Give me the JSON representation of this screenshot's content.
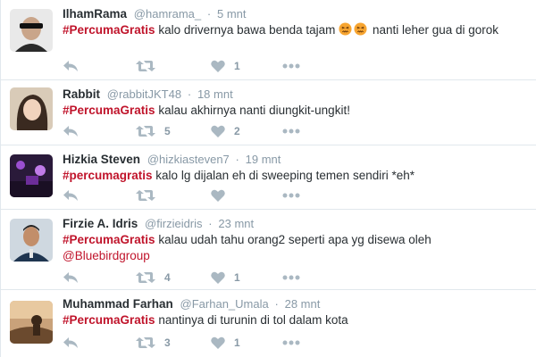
{
  "tweets": [
    {
      "name": "IlhamRama",
      "handle": "@hamrama_",
      "separator": "·",
      "time": "5 mnt",
      "hashtag": "#PercumaGratis",
      "text_before_emoji": " kalo drivernya bawa benda tajam ",
      "emoji": [
        "confounded-face-emoji",
        "confounded-face-emoji"
      ],
      "text_after_emoji": " nanti leher gua di gorok",
      "retweets": "",
      "likes": "1",
      "colors": {
        "bg": "#e9e9e9",
        "accent": "#2b2b2b"
      }
    },
    {
      "name": "Rabbit",
      "handle": "@rabbitJKT48",
      "separator": "·",
      "time": "18 mnt",
      "hashtag": "#PercumaGratis",
      "text": " kalau akhirnya nanti diungkit-ungkit!",
      "retweets": "5",
      "likes": "2",
      "colors": {
        "bg": "#d9cbb8",
        "accent": "#3a2a20"
      }
    },
    {
      "name": "Hizkia Steven",
      "handle": "@hizkiasteven7",
      "separator": "·",
      "time": "19 mnt",
      "hashtag": "#percumagratis",
      "text": " kalo lg dijalan eh di sweeping temen sendiri *eh*",
      "retweets": "",
      "likes": "",
      "colors": {
        "bg": "#2a1a3a",
        "accent": "#9b4fd1"
      }
    },
    {
      "name": "Firzie A. Idris",
      "handle": "@firzieidris",
      "separator": "·",
      "time": "23 mnt",
      "hashtag": "#PercumaGratis",
      "text": " kalau udah tahu orang2 seperti apa yg disewa oleh",
      "mention": "@Bluebirdgroup",
      "retweets": "4",
      "likes": "1",
      "colors": {
        "bg": "#cfd8e0",
        "accent": "#1f3550"
      }
    },
    {
      "name": "Muhammad Farhan",
      "handle": "@Farhan_Umala",
      "separator": "·",
      "time": "28 mnt",
      "hashtag": "#PercumaGratis",
      "text": " nantinya di turunin di tol dalam kota",
      "retweets": "3",
      "likes": "1",
      "colors": {
        "bg": "#c9a27a",
        "accent": "#6b4a2e"
      }
    }
  ],
  "icons": {
    "reply": "reply-icon",
    "retweet": "retweet-icon",
    "like": "heart-icon",
    "more": "more-icon"
  },
  "colors": {
    "hashtag": "#c0142b",
    "meta": "#8899a6",
    "action": "#aab8c2",
    "divider": "#e1e8ed"
  }
}
